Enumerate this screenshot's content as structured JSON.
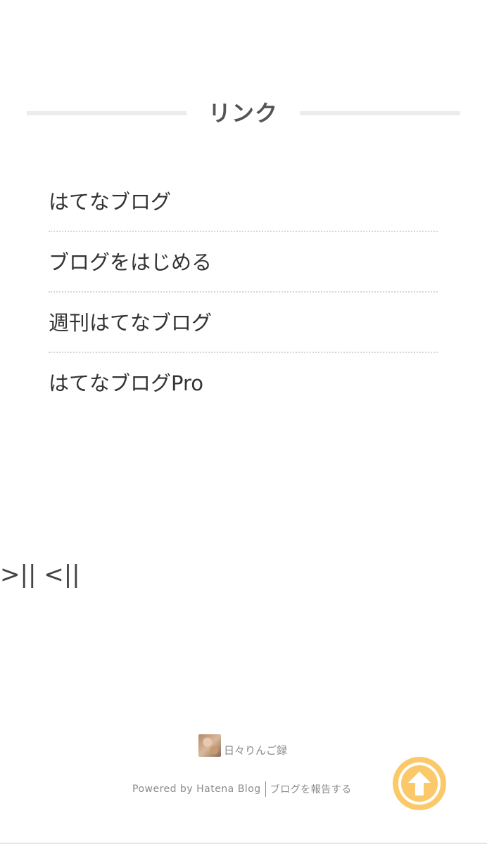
{
  "links_section": {
    "title": "リンク",
    "items": [
      {
        "label": "はてなブログ"
      },
      {
        "label": "ブログをはじめる"
      },
      {
        "label": "週刊はてなブログ"
      },
      {
        "label": "はてなブログPro"
      }
    ]
  },
  "stray_text": ">|| <||",
  "footer": {
    "blog_name": "日々りんご録",
    "powered_by": "Powered by Hatena Blog",
    "report_link": "ブログを報告する"
  },
  "scroll_top": {
    "icon": "arrow-up-icon",
    "color": "#fcc96a"
  }
}
